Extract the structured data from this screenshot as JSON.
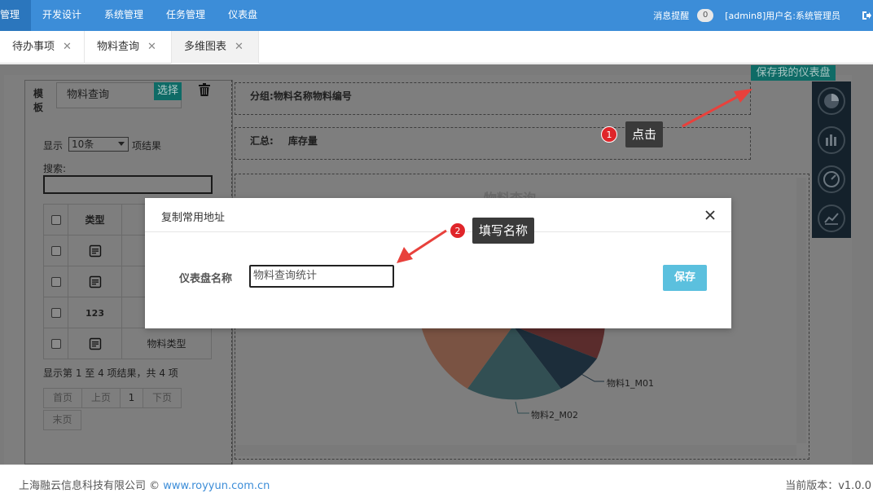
{
  "nav": {
    "items": [
      "管理",
      "开发设计",
      "系统管理",
      "任务管理",
      "仪表盘"
    ],
    "messages_label": "消息提醒",
    "messages_count": "0",
    "user_text": "[admin8]用户名:系统管理员"
  },
  "tabs": [
    {
      "label": "待办事项",
      "close": "✕"
    },
    {
      "label": "物料查询",
      "close": "✕"
    },
    {
      "label": "多维图表",
      "close": "✕"
    }
  ],
  "left_panel": {
    "template_label": "模板",
    "template_value": "物料查询",
    "select_button": "选择",
    "show_label": "显示",
    "page_size": "10条",
    "results_label": "项结果",
    "search_label": "搜索:",
    "table": {
      "header": "类型",
      "rows": [
        {
          "type_icon": "document-icon",
          "text": ""
        },
        {
          "type_icon": "document-icon",
          "text": ""
        },
        {
          "type_icon": "number-icon",
          "type_text": "123",
          "text": ""
        },
        {
          "type_icon": "document-icon",
          "text": "物料类型"
        }
      ]
    },
    "pager_info": "显示第 1 至 4 项结果，共 4 项",
    "pager": {
      "first": "首页",
      "prev": "上页",
      "current": "1",
      "next": "下页",
      "last": "末页"
    }
  },
  "config": {
    "group_label": "分组:",
    "group_value": "物料名称物料编号",
    "sum_label": "汇总:",
    "sum_value": "库存量"
  },
  "chart": {
    "title_partial": "物料查询",
    "labels": [
      "物料1_M01",
      "物料2_M02"
    ],
    "colors": [
      "#5a2c2c",
      "#1c2d3a",
      "#324f53",
      "#7a5343"
    ]
  },
  "save_dashboard_button": "保存我的仪表盘",
  "modal": {
    "title": "复制常用地址",
    "field_label": "仪表盘名称",
    "field_value": "物料查询统计",
    "save_button": "保存"
  },
  "callouts": [
    {
      "step": "1",
      "text": "点击"
    },
    {
      "step": "2",
      "text": "填写名称"
    }
  ],
  "footer": {
    "company": "上海融云信息科技有限公司 © ",
    "link": "www.royyun.com.cn",
    "version": "当前版本：v1.0.0"
  }
}
